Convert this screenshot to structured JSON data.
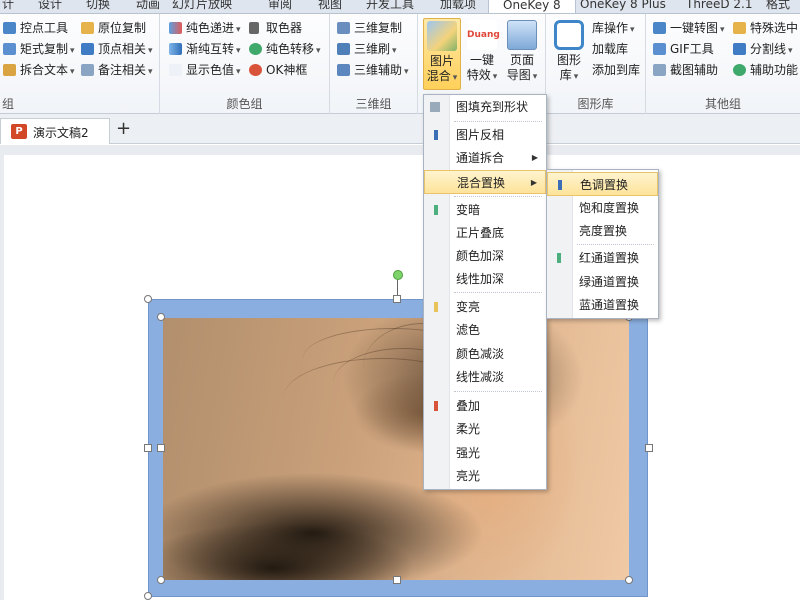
{
  "tabs": [
    "计",
    "设计",
    "切换",
    "动画",
    "幻灯片放映",
    "审阅",
    "视图",
    "开发工具",
    "加载项",
    "OneKey 8",
    "OneKey 8 Plus",
    "ThreeD 2.1",
    "格式"
  ],
  "ribbon": {
    "group1": {
      "label": "组",
      "items": [
        "控点工具",
        "原位复制",
        "矩式复制",
        "顶点相关",
        "拆合文本",
        "备注相关"
      ]
    },
    "group_color": {
      "label": "颜色组",
      "items": [
        "纯色递进",
        "取色器",
        "渐纯互转",
        "纯色转移",
        "显示色值",
        "OK神框"
      ]
    },
    "group_3d": {
      "label": "三维组",
      "items": [
        "三维复制",
        "三维刷",
        "三维辅助"
      ]
    },
    "group_image": {
      "big": [
        {
          "line1": "图片",
          "line2": "混合"
        },
        {
          "line1": "一键",
          "line2": "特效"
        },
        {
          "line1": "页面",
          "line2": "导图"
        }
      ],
      "duang": "Duang"
    },
    "group_library": {
      "label": "图形库",
      "big": {
        "line1": "图形",
        "line2": "库"
      },
      "items": [
        "库操作",
        "加载库",
        "添加到库"
      ]
    },
    "group_other": {
      "label": "其他组",
      "items": [
        "一键转图",
        "特殊选中",
        "GIF工具",
        "分割线",
        "截图辅助",
        "辅助功能"
      ]
    }
  },
  "document": {
    "tab_label": "演示文稿2",
    "ppt_icon": "P",
    "add_tab": "+"
  },
  "menu_main": {
    "items": [
      "图填充到形状",
      "图片反相",
      "通道拆合",
      "混合置换",
      "变暗",
      "正片叠底",
      "颜色加深",
      "线性加深",
      "变亮",
      "滤色",
      "颜色减淡",
      "线性减淡",
      "叠加",
      "柔光",
      "强光",
      "亮光"
    ],
    "highlighted": "混合置换"
  },
  "menu_sub": {
    "items": [
      "色调置换",
      "饱和度置换",
      "亮度置换",
      "红通道置换",
      "绿通道置换",
      "蓝通道置换"
    ],
    "highlighted": "色调置换"
  },
  "colors": {
    "accent": "#ffd05a",
    "frame": "#8aaedf",
    "marker_blue": "#3a6fb5",
    "marker_green": "#4caf7d",
    "marker_yellow": "#e8c35a",
    "marker_red": "#d9533b"
  },
  "icons": [
    "chevron-down-icon",
    "chevron-right-icon",
    "powerpoint-icon",
    "plus-icon",
    "image-blend-icon",
    "rotate-handle-icon"
  ]
}
